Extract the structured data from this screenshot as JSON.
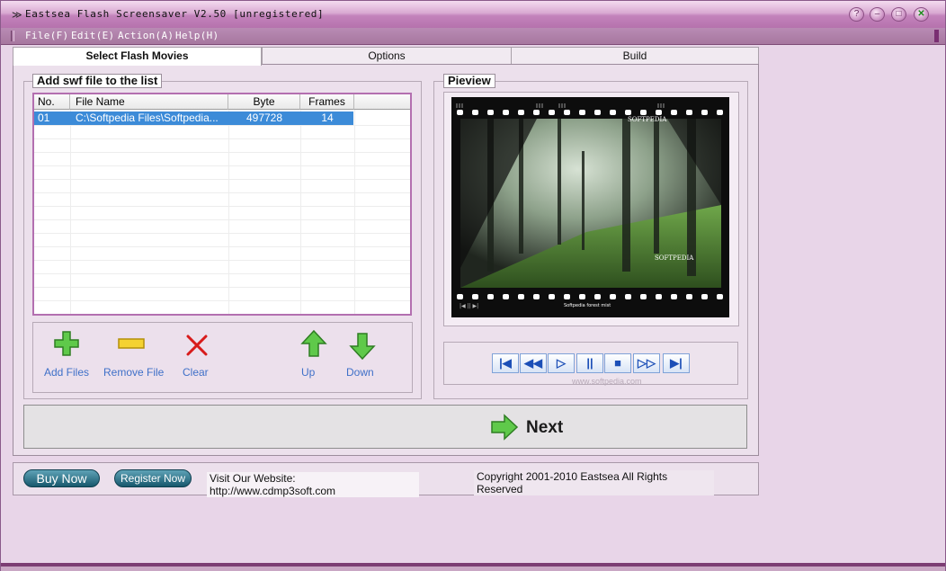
{
  "window": {
    "title": "Eastsea Flash Screensaver V2.50 [unregistered]",
    "icon": "app-icon"
  },
  "menu": [
    "File(F)",
    "Edit(E)",
    "Action(A)",
    "Help(H)"
  ],
  "tabs": [
    {
      "label": "Select Flash Movies",
      "active": true
    },
    {
      "label": "Options",
      "active": false
    },
    {
      "label": "Build",
      "active": false
    }
  ],
  "file_group": {
    "label": "Add swf file to the list"
  },
  "list": {
    "columns": [
      "No.",
      "File Name",
      "Byte",
      "Frames"
    ],
    "rows": [
      {
        "no": "01",
        "file": "C:\\Softpedia Files\\Softpedia...",
        "byte": "497728",
        "frames": "14"
      }
    ]
  },
  "toolbar": {
    "add": "Add Files",
    "remove": "Remove File",
    "clear": "Clear",
    "up": "Up",
    "down": "Down"
  },
  "preview": {
    "label": "Pieview",
    "watermark_top": "SOFTPEDIA",
    "watermark_mid": "SOFTPEDIA",
    "caption": "Softpedia forest mist",
    "controls_watermark": "www.softpedia.com"
  },
  "player_controls": [
    "first-icon",
    "rewind-icon",
    "play-icon",
    "pause-icon",
    "stop-icon",
    "forward-icon",
    "last-icon"
  ],
  "next": {
    "label": "Next"
  },
  "footer": {
    "buy": "Buy Now",
    "register": "Register Now",
    "website": "Visit Our Website: http://www.cdmp3soft.com",
    "copyright": "Copyright 2001-2010 Eastsea All Rights Reserved"
  },
  "colors": {
    "accent": "#b36fb0",
    "selection": "#3c8bd8",
    "title_bar": "#c383bb",
    "link_blue": "#3f70c8"
  }
}
